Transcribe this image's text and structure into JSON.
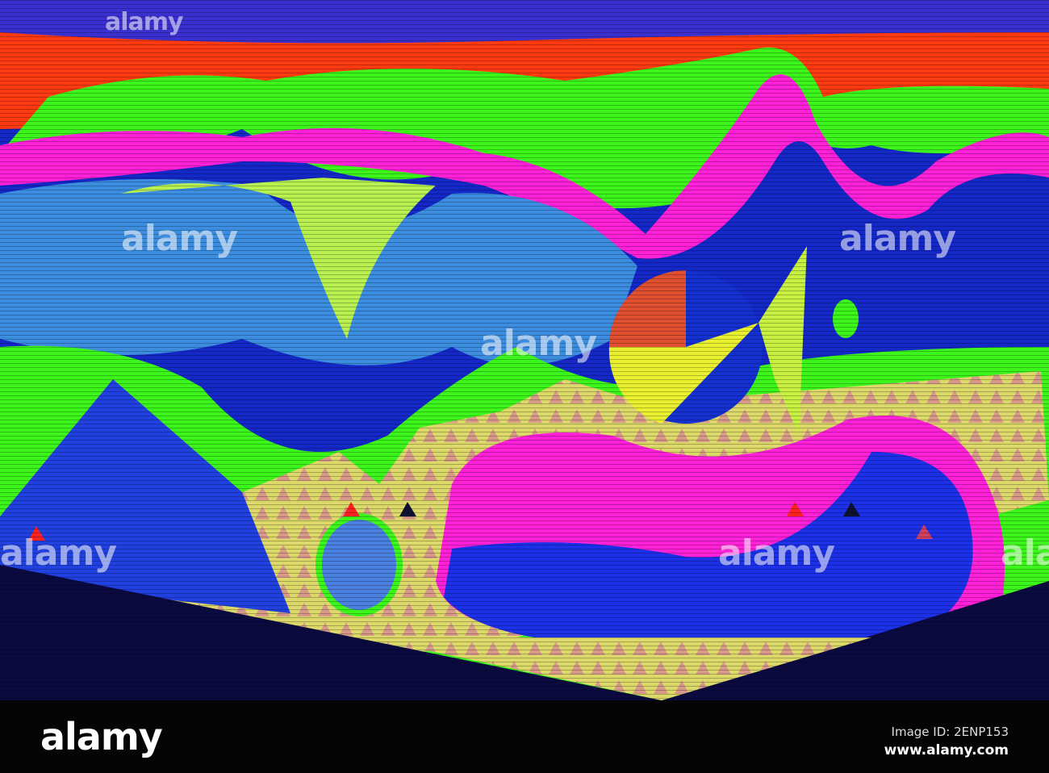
{
  "watermark": {
    "text": "alamy"
  },
  "footer": {
    "logo": "alamy",
    "image_id": "Image ID: 2ENP153",
    "site": "www.alamy.com"
  },
  "colors": {
    "green": "#39ff1a",
    "magenta": "#ff1fd8",
    "blue": "#1020e0",
    "red": "#ff2a10",
    "yellow": "#dce86a",
    "background": "#050505"
  }
}
